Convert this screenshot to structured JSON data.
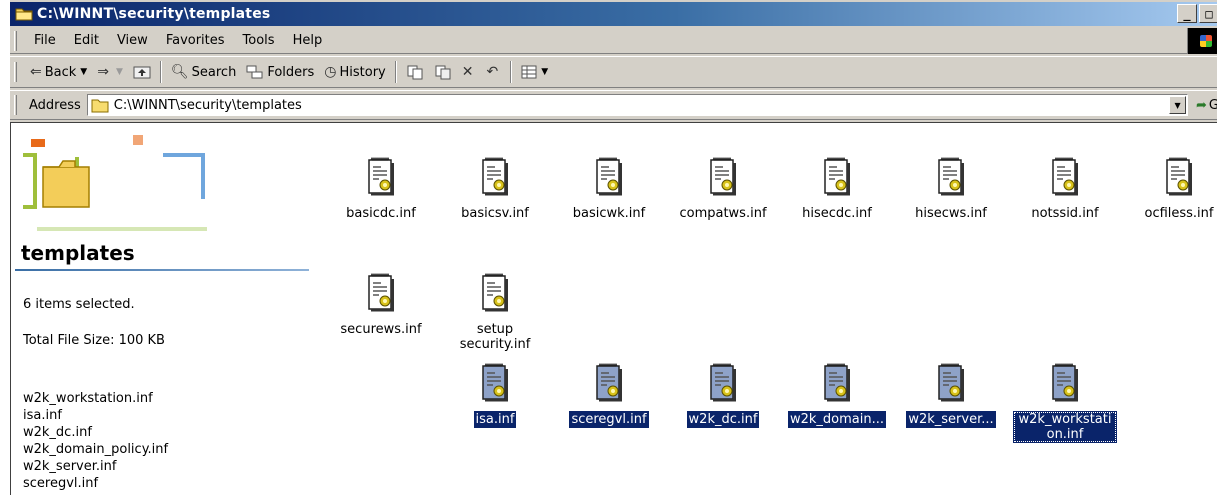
{
  "window": {
    "title": "C:\\WINNT\\security\\templates"
  },
  "title_buttons": {
    "minimize": "_",
    "maximize": "□"
  },
  "menu": [
    "File",
    "Edit",
    "View",
    "Favorites",
    "Tools",
    "Help"
  ],
  "toolbar": {
    "back": "Back",
    "search": "Search",
    "folders": "Folders",
    "history": "History"
  },
  "address": {
    "label": "Address",
    "value": "C:\\WINNT\\security\\templates",
    "go_label": "G"
  },
  "left_pane": {
    "title": "templates",
    "selection_status": "6 items selected.",
    "total_size": "Total File Size: 100 KB",
    "selected_files": [
      "w2k_workstation.inf",
      "isa.inf",
      "w2k_dc.inf",
      "w2k_domain_policy.inf",
      "w2k_server.inf",
      "sceregvl.inf"
    ]
  },
  "files": [
    {
      "name": "basicdc.inf",
      "selected": false
    },
    {
      "name": "basicsv.inf",
      "selected": false
    },
    {
      "name": "basicwk.inf",
      "selected": false
    },
    {
      "name": "compatws.inf",
      "selected": false
    },
    {
      "name": "hisecdc.inf",
      "selected": false
    },
    {
      "name": "hisecws.inf",
      "selected": false
    },
    {
      "name": "notssid.inf",
      "selected": false
    },
    {
      "name": "ocfiless.inf",
      "selected": false
    },
    {
      "name": "securews.inf",
      "selected": false
    },
    {
      "name": "setup security.inf",
      "selected": false
    },
    {
      "name": "isa.inf",
      "selected": true
    },
    {
      "name": "sceregvl.inf",
      "selected": true
    },
    {
      "name": "w2k_dc.inf",
      "selected": true
    },
    {
      "name": "w2k_domain...",
      "selected": true
    },
    {
      "name": "w2k_server...",
      "selected": true
    },
    {
      "name": "w2k_workstation.inf",
      "selected": true,
      "focused": true
    }
  ],
  "colors": {
    "titlebar_start": "#0a246a",
    "titlebar_end": "#a6caf0",
    "selection": "#0a246a",
    "chrome": "#d4d0c8"
  }
}
